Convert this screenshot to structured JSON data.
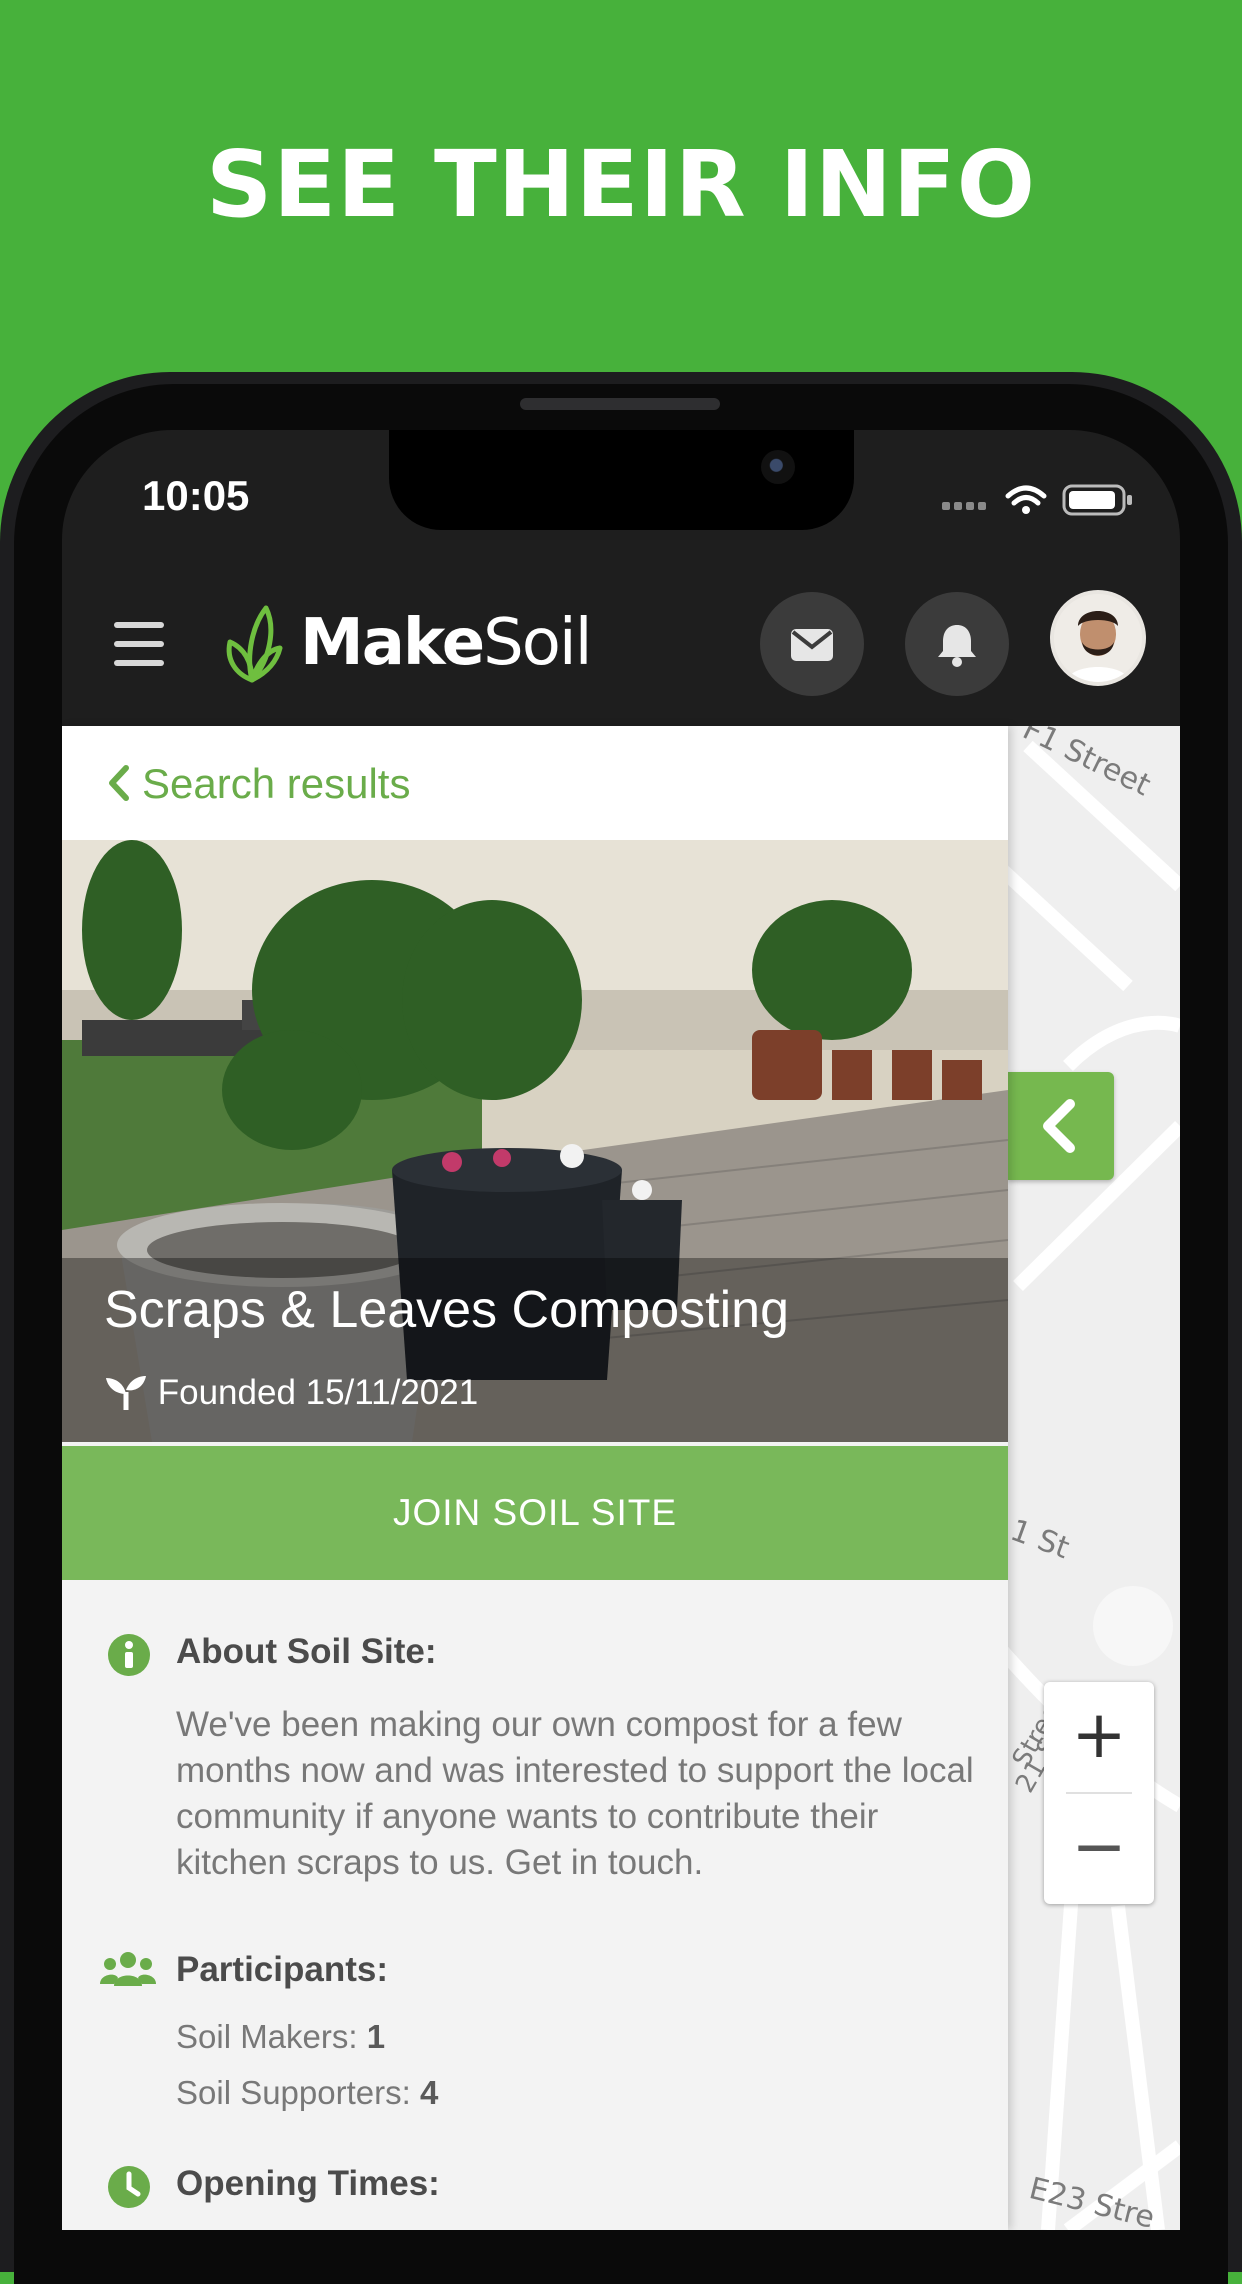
{
  "headline": "SEE THEIR INFO",
  "status_bar": {
    "time": "10:05"
  },
  "app_bar": {
    "brand_bold": "Make",
    "brand_regular": "Soil",
    "menu_icon": "menu-icon",
    "mail_icon": "envelope-icon",
    "notification_icon": "bell-icon"
  },
  "panel": {
    "back_label": "Search results",
    "site_title": "Scraps & Leaves Composting",
    "founded": "Founded 15/11/2021",
    "join_label": "JOIN SOIL SITE",
    "about": {
      "heading": "About Soil Site:",
      "text": "We've been making our own compost for a few months now and was interested to support the local community if anyone wants to contribute their kitchen scraps to us. Get in touch."
    },
    "participants": {
      "heading": "Participants:",
      "makers_label": "Soil Makers:",
      "makers_value": "1",
      "supporters_label": "Soil Supporters:",
      "supporters_value": "4"
    },
    "opening_times": {
      "heading": "Opening Times:"
    }
  },
  "map": {
    "labels": [
      "F1 Street",
      "1 St",
      "Street",
      "21 St",
      "E23 Stre"
    ],
    "zoom_in": "+",
    "zoom_out": "−"
  },
  "colors": {
    "background_green": "#47b13b",
    "accent_green": "#79b85a",
    "link_green": "#6aac4a",
    "appbar_dark": "#1e1e1e"
  }
}
